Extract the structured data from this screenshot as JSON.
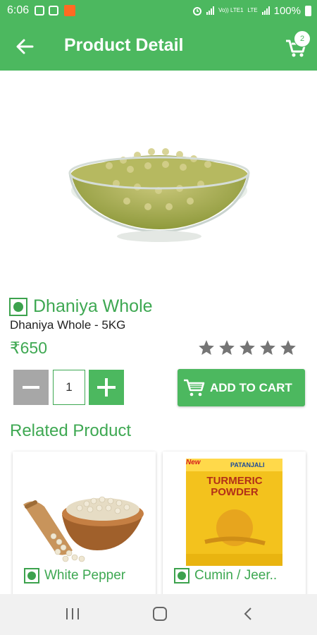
{
  "status_bar": {
    "time": "6:06",
    "network_label": "Vo)) LTE1",
    "network_type": "LTE",
    "battery": "100%"
  },
  "app_bar": {
    "title": "Product Detail",
    "cart_count": "2",
    "back_icon": "arrow-left-icon",
    "cart_icon": "shopping-cart-icon"
  },
  "product": {
    "name": "Dhaniya Whole",
    "subtitle": "Dhaniya Whole - 5KG",
    "price": "₹650",
    "rating": 0,
    "rating_max": 5,
    "quantity": "1",
    "add_to_cart_label": "ADD TO CART"
  },
  "related": {
    "title": "Related Product",
    "items": [
      {
        "name": "White Pepper"
      },
      {
        "name": "Cumin / Jeer..",
        "pack_brand": "PATANJALI",
        "pack_title": "TURMERIC POWDER",
        "pack_badge": "New"
      }
    ]
  },
  "colors": {
    "primary": "#4cb85f",
    "accent_text": "#3ea852",
    "star": "#757575",
    "minus_button": "#a7a7a7"
  }
}
